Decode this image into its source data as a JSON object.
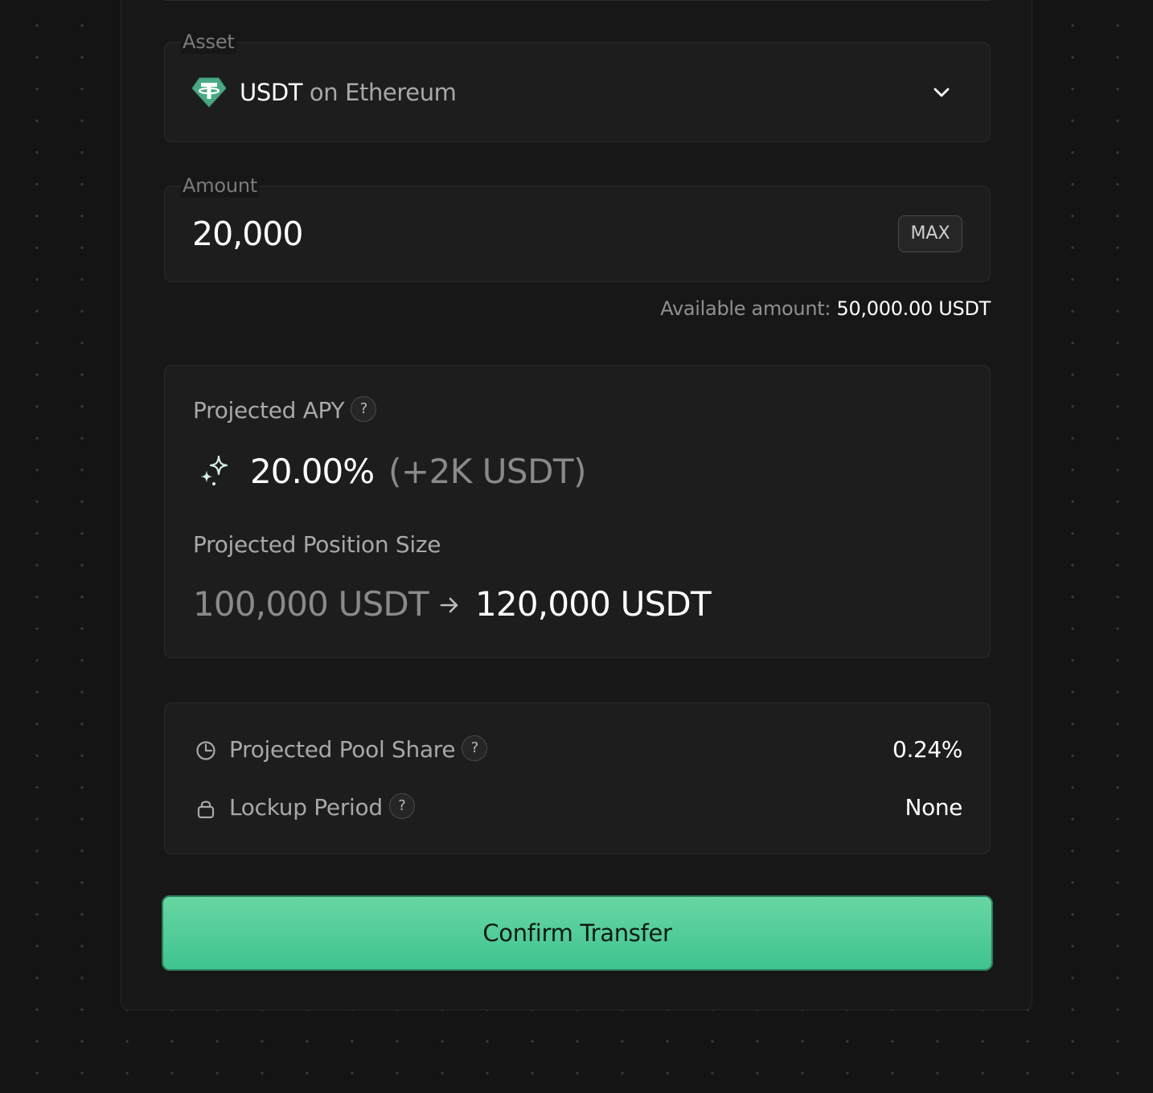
{
  "asset": {
    "label": "Asset",
    "symbol": "USDT",
    "network": "on Ethereum",
    "icon": "tether-icon"
  },
  "amount": {
    "label": "Amount",
    "value": "20,000",
    "max_label": "MAX",
    "available_label": "Available amount:",
    "available_value": "50,000.00 USDT"
  },
  "projection": {
    "apy_title": "Projected APY",
    "help_symbol": "?",
    "apy_value": "20.00%",
    "apy_extra": "(+2K USDT)",
    "position_title": "Projected Position Size",
    "position_from": "100,000 USDT",
    "position_to": "120,000 USDT"
  },
  "details": {
    "pool_share_label": "Projected Pool Share",
    "pool_share_value": "0.24%",
    "lockup_label": "Lockup Period",
    "lockup_value": "None"
  },
  "actions": {
    "confirm_label": "Confirm Transfer"
  },
  "colors": {
    "accent": "#4fcb96",
    "background": "#141414",
    "card": "#1d1d1d"
  }
}
